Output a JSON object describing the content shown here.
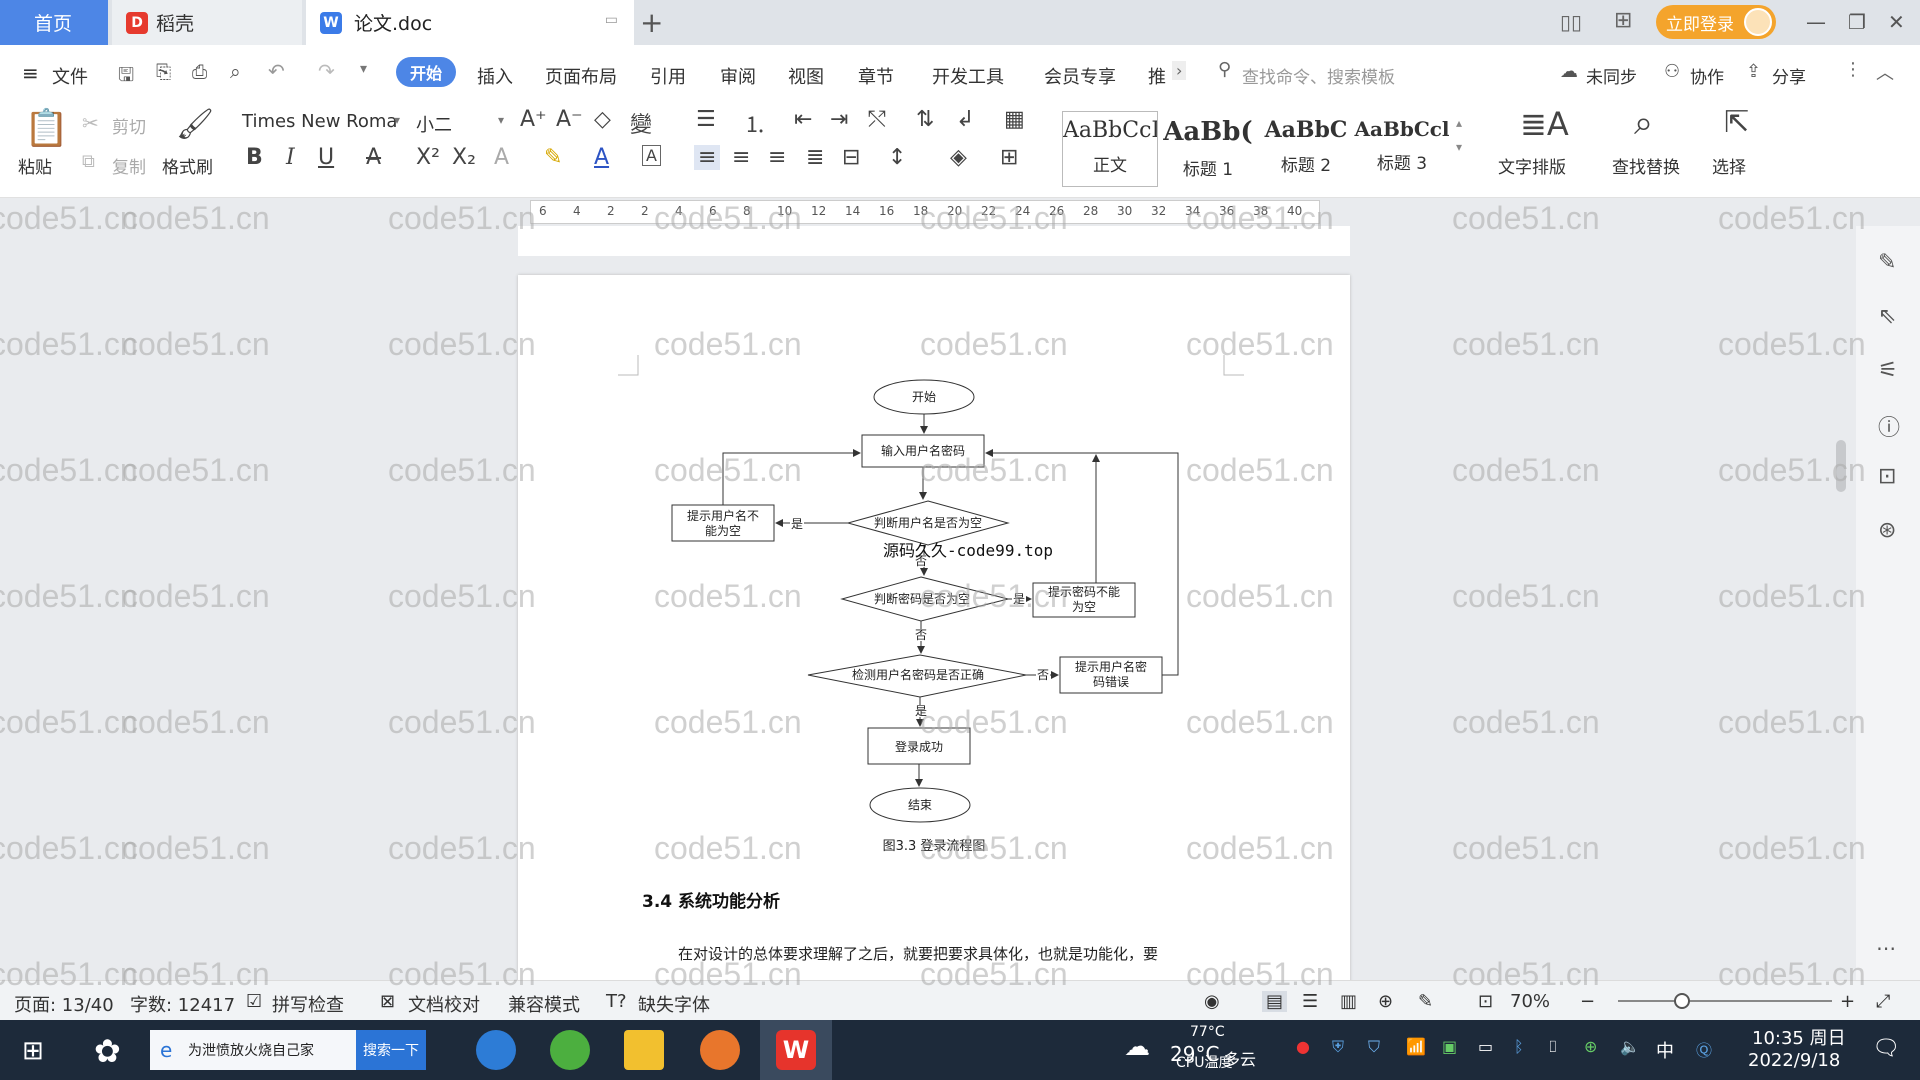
{
  "tabs": {
    "home": "首页",
    "docer": "稻壳",
    "doc": "论文.doc"
  },
  "header": {
    "login": "立即登录"
  },
  "menu": [
    "文件",
    "开始",
    "插入",
    "页面布局",
    "引用",
    "审阅",
    "视图",
    "章节",
    "开发工具",
    "会员专享",
    "推"
  ],
  "menu_right": {
    "search_cmd": "查找命令、搜索模板",
    "sync": "未同步",
    "collab": "协作",
    "share": "分享"
  },
  "ribbon": {
    "paste": "粘贴",
    "cut": "剪切",
    "copy": "复制",
    "format_painter": "格式刷",
    "font": "Times New Roma",
    "size": "小二",
    "styles": [
      {
        "preview": "AaBbCcI",
        "name": "正文"
      },
      {
        "preview": "AaBb(",
        "name": "标题 1"
      },
      {
        "preview": "AaBbC",
        "name": "标题 2"
      },
      {
        "preview": "AaBbCcl",
        "name": "标题 3"
      }
    ],
    "text_layout": "文字排版",
    "find_replace": "查找替换",
    "select": "选择"
  },
  "ruler": {
    "ticks": [
      "6",
      "4",
      "2",
      "2",
      "4",
      "6",
      "8",
      "10",
      "12",
      "14",
      "16",
      "18",
      "20",
      "22",
      "24",
      "26",
      "28",
      "30",
      "32",
      "34",
      "36",
      "38",
      "40"
    ]
  },
  "document": {
    "flowchart": {
      "start": "开始",
      "input": "输入用户名密码",
      "check_user": "判断用户名是否为空",
      "warn_user": [
        "提示用户名不",
        "能为空"
      ],
      "check_pwd": "判断密码是否为空",
      "warn_pwd": [
        "提示密码不能",
        "为空"
      ],
      "check_both": "检测用户名密码是否正确",
      "warn_both": [
        "提示用户名密",
        "码错误"
      ],
      "success": "登录成功",
      "end": "结束",
      "yes": "是",
      "no": "否"
    },
    "overlay_watermark": "源码久久-code99.top",
    "caption": "图3.3 登录流程图",
    "section_heading": "3.4 系统功能分析",
    "paragraph": "在对设计的总体要求理解了之后，就要把要求具体化，也就是功能化，要"
  },
  "status": {
    "page": "页面: 13/40",
    "words": "字数: 12417",
    "spell": "拼写检查",
    "proof": "文档校对",
    "compat": "兼容模式",
    "missing_font": "缺失字体",
    "zoom": "70%"
  },
  "taskbar": {
    "search_text": "为泄愤放火烧自己家",
    "search_btn": "搜索一下",
    "weather_temp": "29°C",
    "weather": "多云",
    "cpu_temp": "77°C",
    "cpu_label": "CPU温度",
    "ime": "中",
    "time": "10:35 周日",
    "date": "2022/9/18"
  },
  "watermark_text": "code51.cn"
}
